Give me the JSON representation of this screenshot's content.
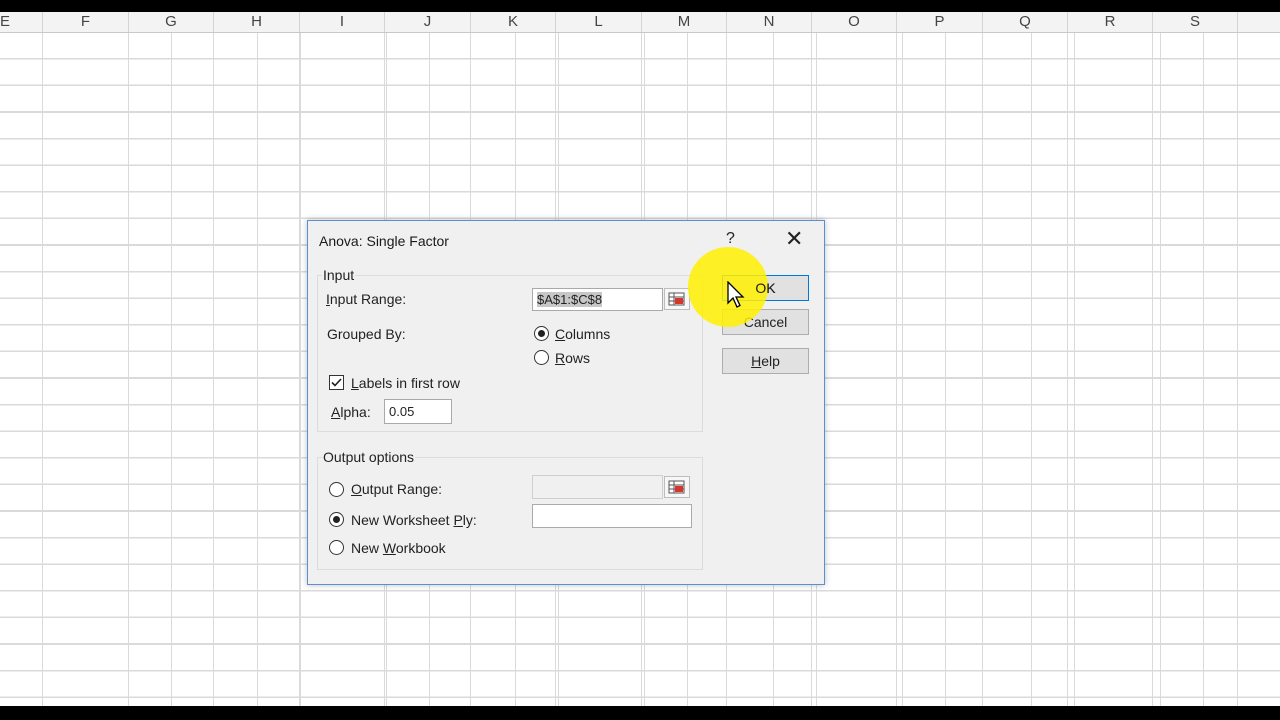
{
  "spreadsheet": {
    "columns": [
      "E",
      "F",
      "G",
      "H",
      "I",
      "J",
      "K",
      "L",
      "M",
      "N",
      "O",
      "P",
      "Q",
      "R",
      "S"
    ]
  },
  "dialog": {
    "title": "Anova: Single Factor",
    "help_glyph": "?",
    "close_glyph": "✕",
    "input_group": {
      "label": "Input",
      "input_range_label": "Input Range:",
      "input_range_value": "$A$1:$C$8",
      "grouped_by_label": "Grouped By:",
      "columns_label": "Columns",
      "rows_label": "Rows",
      "grouped_by_selected": "Columns",
      "labels_checkbox_label": "Labels in first row",
      "labels_checked": true,
      "alpha_label": "Alpha:",
      "alpha_value": "0.05"
    },
    "output_group": {
      "label": "Output options",
      "output_range_label": "Output Range:",
      "new_worksheet_label": "New Worksheet Ply:",
      "new_workbook_label": "New Workbook",
      "selected": "New Worksheet Ply"
    },
    "buttons": {
      "ok": "OK",
      "cancel": "Cancel",
      "help": "Help"
    }
  },
  "colors": {
    "dialog_border": "#5b8fd1",
    "highlight": "#fff000",
    "default_button_border": "#0078d7"
  }
}
